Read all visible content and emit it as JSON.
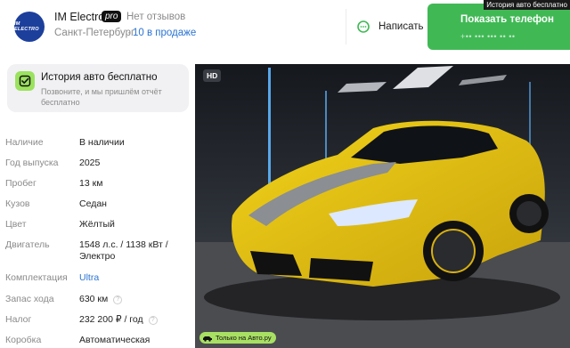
{
  "seller": {
    "logo_text": "IM ELECTRO",
    "name": "IM Electro",
    "pro_badge": "pro",
    "reviews": "Нет отзывов",
    "city": "Санкт-Петербург",
    "separator": "·",
    "for_sale": "10 в продаже"
  },
  "actions": {
    "message_label": "Написать",
    "phone_label": "Показать телефон",
    "phone_mask": "+•• ••• ••• •• ••"
  },
  "corner_label": "История авто бесплатно",
  "history_card": {
    "title": "История авто бесплатно",
    "subtitle": "Позвоните, и мы пришлём отчёт бесплатно"
  },
  "specs": [
    {
      "label": "Наличие",
      "value": "В наличии"
    },
    {
      "label": "Год выпуска",
      "value": "2025"
    },
    {
      "label": "Пробег",
      "value": "13 км"
    },
    {
      "label": "Кузов",
      "value": "Седан"
    },
    {
      "label": "Цвет",
      "value": "Жёлтый"
    },
    {
      "label": "Двигатель",
      "value": "1548 л.с. / 1138 кВт / Электро"
    },
    {
      "label": "Комплектация",
      "value": "Ultra"
    },
    {
      "label": "Запас хода",
      "value": "630 км"
    },
    {
      "label": "Налог",
      "value": "232 200 ₽ / год"
    },
    {
      "label": "Коробка",
      "value": "Автоматическая"
    }
  ],
  "photo": {
    "hd_badge": "HD",
    "only_badge": "Только на Авто.ру"
  },
  "colors": {
    "accent_green": "#40b955",
    "link_blue": "#2a73d4",
    "car_yellow": "#e9c415"
  }
}
